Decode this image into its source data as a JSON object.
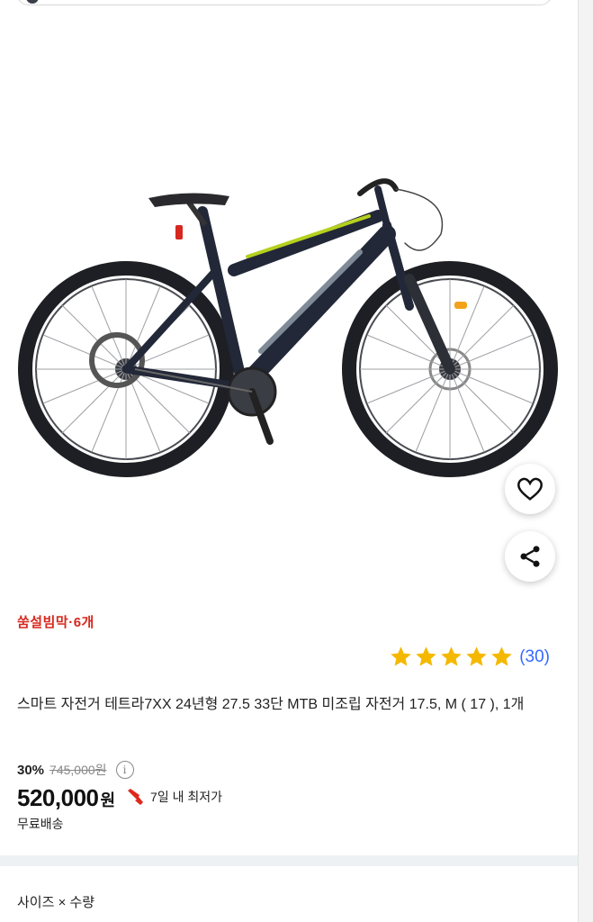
{
  "promo": {
    "text": "쑴설빔막·6개"
  },
  "rating": {
    "stars": 5,
    "count": "(30)",
    "star_color": "#f5b800"
  },
  "product": {
    "title": "스마트 자전거 테트라7XX 24년형 27.5 33단 MTB 미조립 자전거 17.5, M ( 17 ), 1개"
  },
  "price": {
    "discount": "30%",
    "original": "745,000원",
    "current": "520,000",
    "currency": "원",
    "lowest_label": "7일 내 최저가",
    "shipping": "무료배송"
  },
  "options": {
    "label": "사이즈 × 수량"
  },
  "icons": {
    "wishlist": "heart-icon",
    "share": "share-icon",
    "info": "info-icon",
    "lowest": "hand-pointer-icon"
  },
  "colors": {
    "promo": "#d6281f",
    "rating_count": "#346aff",
    "accent_lime": "#b5d01f"
  }
}
